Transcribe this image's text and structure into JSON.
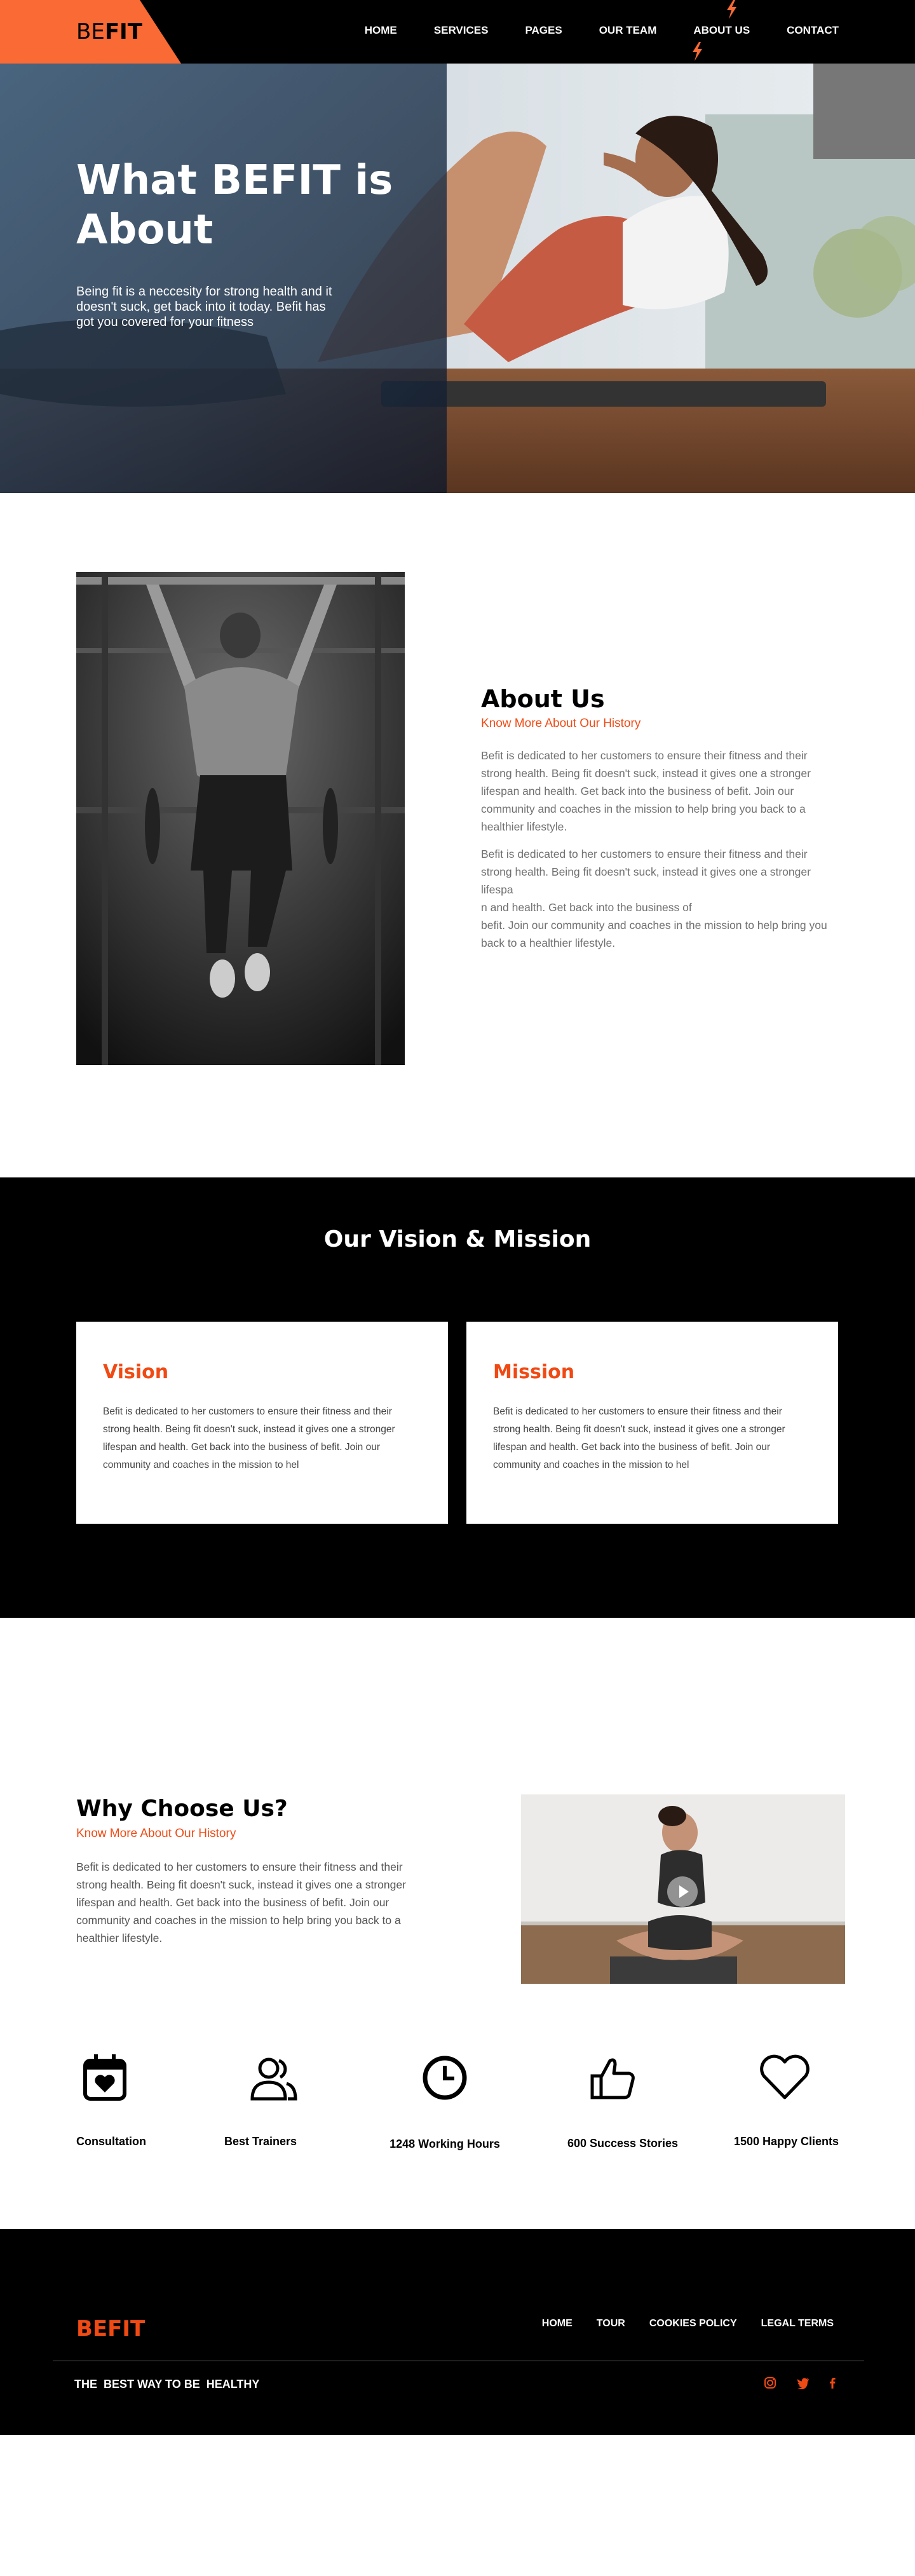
{
  "nav": {
    "logo_be": "BE",
    "logo_fit": "FIT",
    "links": [
      "HOME",
      "SERVICES",
      "PAGES",
      "OUR TEAM",
      "ABOUT US",
      "CONTACT"
    ]
  },
  "hero": {
    "title": "What BEFIT is About",
    "text": "Being fit is a neccesity for strong health and it doesn't suck, get back  into it today. Befit has got you covered for your fitness"
  },
  "about": {
    "title": "About Us",
    "subtitle": "Know More About Our History",
    "paragraph1": "Befit is dedicated to her customers to ensure their fitness and their strong health. Being fit doesn't suck, instead it gives one a stronger lifespan and health. Get back into the business of befit. Join our community and coaches in the mission to help bring you back to a healthier lifestyle.",
    "paragraph2": "Befit is dedicated to her customers to ensure their fitness and their strong health. Being fit doesn't suck, instead it gives one a stronger lifespa\nn and health. Get back into the business of\nbefit. Join our community and coaches in the mission to help bring you back to a healthier lifestyle."
  },
  "vision": {
    "title": "Our Vision & Mission",
    "cards": [
      {
        "title": "Vision",
        "text": "Befit is dedicated to her customers to ensure their fitness and their strong health. Being fit doesn't suck, instead it gives one a stronger lifespan and health. Get back into the business of befit. Join our community and coaches in the mission to hel"
      },
      {
        "title": "Mission",
        "text": "Befit is dedicated to her customers to ensure their fitness and their strong health. Being fit doesn't suck, instead it gives one a stronger lifespan and health. Get back into the business of befit. Join our community and coaches in the mission to hel"
      }
    ]
  },
  "why": {
    "title": "Why Choose Us?",
    "subtitle": "Know More About Our History",
    "text": "Befit is dedicated to her customers to ensure their fitness and their strong health. Being fit doesn't suck, instead it gives one a stronger lifespan and health. Get back into the business of befit. Join our community and coaches in the mission to help bring you back to a healthier lifestyle."
  },
  "features": [
    {
      "icon": "calendar-heart-icon",
      "label": "Consultation"
    },
    {
      "icon": "users-icon",
      "label": "Best Trainers"
    },
    {
      "icon": "clock-icon",
      "label": "1248 Working Hours"
    },
    {
      "icon": "thumbs-up-icon",
      "label": "600 Success Stories"
    },
    {
      "icon": "heart-icon",
      "label": "1500 Happy Clients"
    }
  ],
  "footer": {
    "logo": "BEFIT",
    "links": [
      "HOME",
      "TOUR",
      "COOKIES POLICY",
      "LEGAL TERMS"
    ],
    "tagline": "THE  BEST WAY TO BE  HEALTHY",
    "social": [
      "instagram-icon",
      "twitter-icon",
      "facebook-icon"
    ]
  },
  "colors": {
    "accent": "#f04a14",
    "logo_tab": "#f96a35",
    "dark": "#000000"
  }
}
